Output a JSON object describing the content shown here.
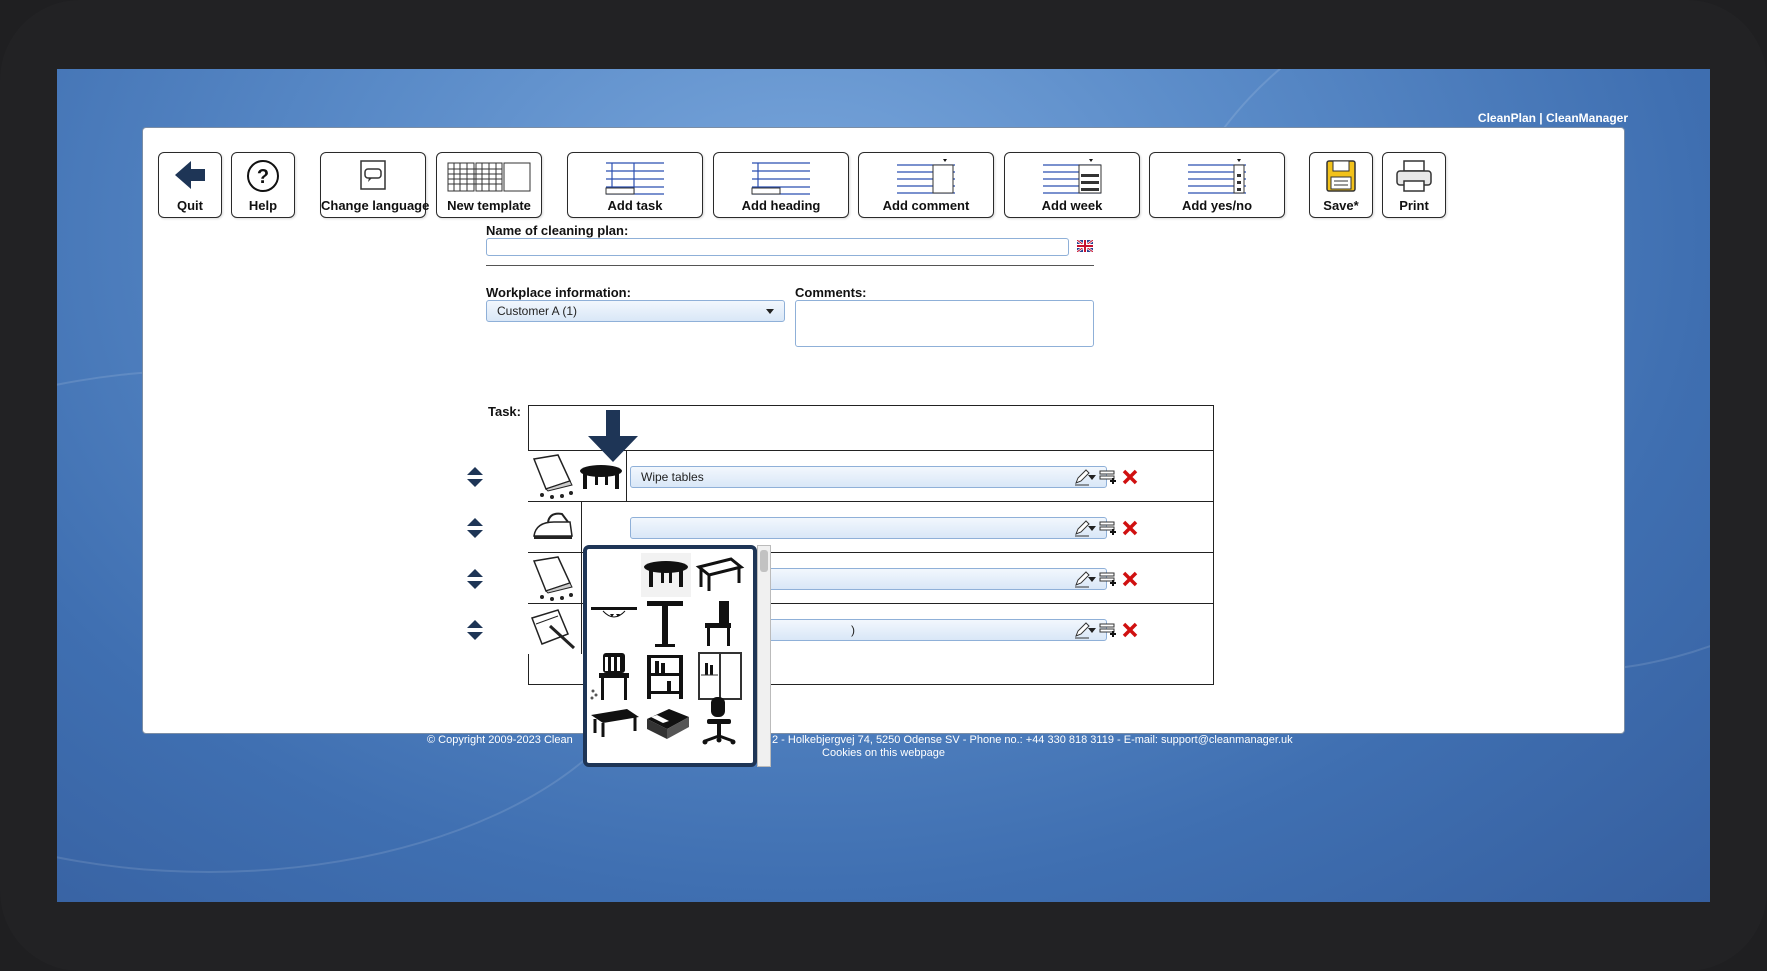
{
  "header": {
    "brand": "CleanPlan | CleanManager"
  },
  "toolbar": {
    "quit": "Quit",
    "help": "Help",
    "change_language": "Change language",
    "new_template": "New template",
    "add_task": "Add task",
    "add_heading": "Add heading",
    "add_comment": "Add comment",
    "add_week": "Add week",
    "add_yesno": "Add yes/no",
    "save": "Save*",
    "print": "Print"
  },
  "form": {
    "name_label": "Name of cleaning plan:",
    "name_value": "",
    "workplace_label": "Workplace information:",
    "workplace_value": "Customer A (1)",
    "comments_label": "Comments:",
    "comments_value": "",
    "task_label": "Task:"
  },
  "tasks": [
    {
      "task": "Wipe tables",
      "icon1": "cloth-icon",
      "icon2": "table-icon"
    },
    {
      "task": "",
      "icon1": "iron-icon"
    },
    {
      "task": "",
      "icon1": "cloth-icon"
    },
    {
      "task": ")",
      "icon1": "squeegee-icon"
    }
  ],
  "icon_picker": {
    "items": [
      "blank",
      "round-table-icon",
      "desk-icon",
      "half-table-icon",
      "tall-table-icon",
      "chair-icon",
      "wooden-chair-icon",
      "shelf-icon",
      "cabinet-icon",
      "bench-icon",
      "sofa-icon",
      "office-chair-icon"
    ]
  },
  "footer": {
    "copyright_left": "© Copyright 2009-2023 Clean",
    "copyright_right": "2 - Holkebjergvej 74, 5250 Odense SV - Phone no.: +44 330 818 3119 - E-mail: support@cleanmanager.uk",
    "cookies": "Cookies on this webpage"
  },
  "colors": {
    "accent": "#1e3556",
    "delete": "#d01010",
    "field_border": "#8fb0d8"
  }
}
